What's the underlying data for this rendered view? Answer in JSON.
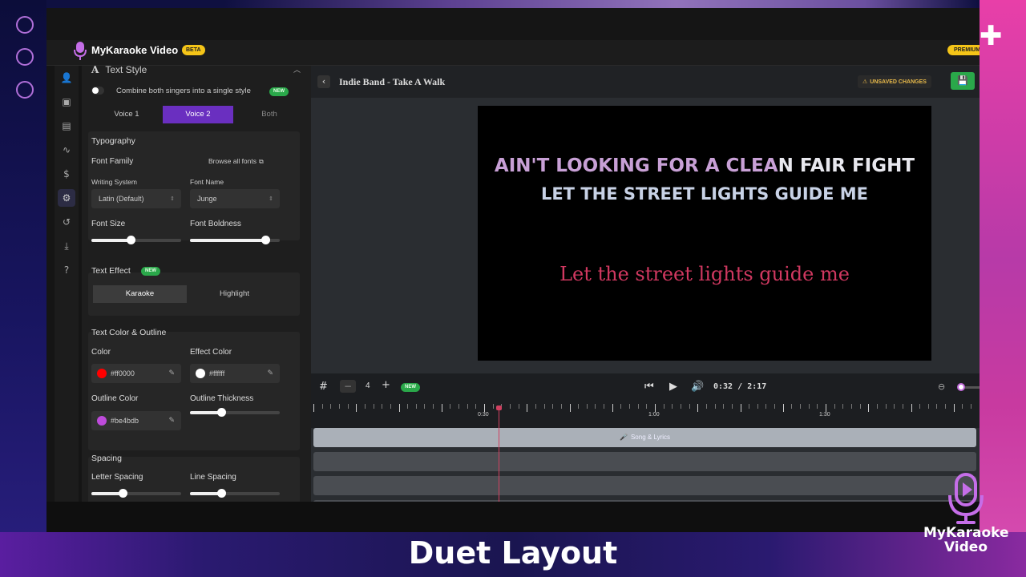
{
  "app": {
    "name": "MyKaraoke Video",
    "beta_badge": "BETA",
    "premium_badge": "PREMIUM"
  },
  "panel": {
    "title": "Text Style",
    "combine_label": "Combine both singers into a single style",
    "combine_new": "NEW",
    "voice_tabs": [
      "Voice 1",
      "Voice 2",
      "Both"
    ],
    "typography": {
      "title": "Typography",
      "font_family_label": "Font Family",
      "browse_fonts": "Browse all fonts",
      "writing_system_label": "Writing System",
      "writing_system_value": "Latin (Default)",
      "font_name_label": "Font Name",
      "font_name_value": "Junge",
      "font_size_label": "Font Size",
      "font_size_level": 0.44,
      "font_boldness_label": "Font Boldness",
      "font_boldness_level": 0.84
    },
    "text_effect": {
      "title": "Text Effect",
      "new": "NEW",
      "options": [
        "Karaoke",
        "Highlight"
      ],
      "selected": "Karaoke"
    },
    "color_outline": {
      "title": "Text Color & Outline",
      "color_label": "Color",
      "color_value": "#ff0000",
      "effect_color_label": "Effect Color",
      "effect_color_value": "#ffffff",
      "outline_color_label": "Outline Color",
      "outline_color_value": "#be4bdb",
      "outline_thickness_label": "Outline Thickness",
      "outline_thickness_level": 0.35
    },
    "spacing": {
      "title": "Spacing",
      "letter_spacing_label": "Letter Spacing",
      "letter_spacing_level": 0.35,
      "line_spacing_label": "Line Spacing",
      "line_spacing_level": 0.35
    }
  },
  "editor": {
    "project_title": "Indie Band - Take A Walk",
    "unsaved": "UNSAVED CHANGES",
    "lyrics": {
      "line1_sung": "AIN'T LOOKING FOR A CLEA",
      "line1_unsung": "N FAIR FIGHT",
      "line2": "LET THE STREET LIGHTS GUIDE ME",
      "line3": "Let the street lights guide me"
    },
    "timeline": {
      "grid_count": "4",
      "new": "NEW",
      "current_time": "0:32",
      "total_time": "2:17",
      "time_separator": "/",
      "ticks": [
        "0:30",
        "1:00",
        "1:30"
      ],
      "song_track_label": "Song & Lyrics"
    }
  },
  "overlay": {
    "caption": "Duet Layout",
    "brand_line1": "MyKaraoke",
    "brand_line2": "Video"
  },
  "colors": {
    "accent_purple": "#6a2fc0",
    "new_green": "#2aa84a",
    "badge_yellow": "#f5c518",
    "playhead": "#d04060",
    "voice2_red": "#d03860"
  }
}
